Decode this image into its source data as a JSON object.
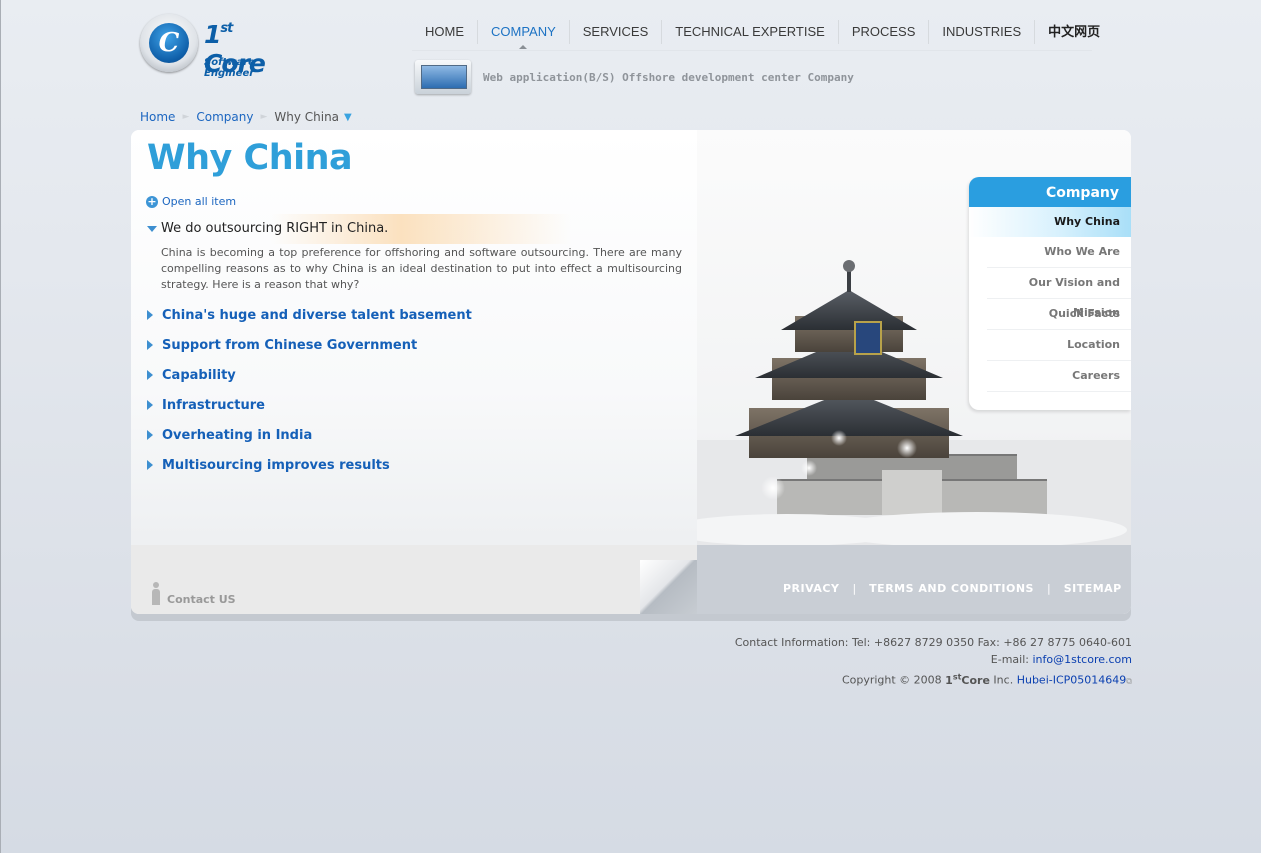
{
  "logo": {
    "mark": "C",
    "name_prefix": "1",
    "name_sup": "st",
    "name_suffix": " Core",
    "subtitle": "Software Engineer"
  },
  "nav": {
    "items": [
      {
        "label": "HOME"
      },
      {
        "label": "COMPANY"
      },
      {
        "label": "SERVICES"
      },
      {
        "label": "TECHNICAL EXPERTISE"
      },
      {
        "label": "PROCESS"
      },
      {
        "label": "INDUSTRIES"
      },
      {
        "label": "中文网页"
      }
    ],
    "active": "COMPANY"
  },
  "tagline": "Web application(B/S) Offshore development center Company",
  "breadcrumb": {
    "home": "Home",
    "company": "Company",
    "current": "Why China",
    "drop_icon": "▼"
  },
  "main": {
    "title": "Why China",
    "open_all": "Open all item",
    "open_item": {
      "title": "We do outsourcing RIGHT in China.",
      "body": "China is becoming a top preference for offshoring and software outsourcing. There are many compelling reasons as to why China is an ideal destination to put into effect a multisourcing strategy. Here is a reason that why?"
    },
    "items": [
      {
        "label": "China's huge and diverse talent basement"
      },
      {
        "label": "Support from Chinese Government"
      },
      {
        "label": "Capability"
      },
      {
        "label": "Infrastructure"
      },
      {
        "label": "Overheating in India"
      },
      {
        "label": "Multisourcing improves results"
      }
    ],
    "contact_us": "Contact US"
  },
  "submenu": {
    "title": "Company",
    "items": [
      {
        "label": "Why China",
        "active": true
      },
      {
        "label": "Who We Are"
      },
      {
        "label": "Our Vision and Mission"
      },
      {
        "label": "Quick Facts"
      },
      {
        "label": "Location"
      },
      {
        "label": "Careers"
      }
    ]
  },
  "footer_links": {
    "privacy": "PRIVACY",
    "terms": "TERMS AND CONDITIONS",
    "sitemap": "SITEMAP",
    "separator": "|"
  },
  "footer_info": {
    "contact": "Contact Information: Tel: +8627 8729 0350 Fax: +86 27 8775 0640-601",
    "email_label": "E-mail: ",
    "email": "info@1stcore.com",
    "copyright_prefix": "Copyright © 2008 ",
    "brand_prefix": "1",
    "brand_sup": "st",
    "brand_suffix": "Core",
    "copyright_suffix": " Inc. ",
    "icp": "Hubei-ICP05014649"
  },
  "colors": {
    "accent": "#2f9fd9",
    "link": "#1560b8",
    "submenu_head": "#2a9ee0"
  }
}
